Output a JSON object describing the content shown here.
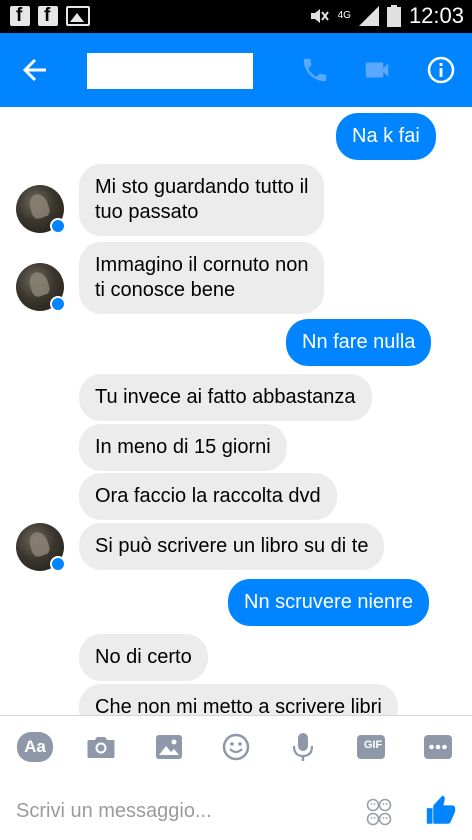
{
  "status_bar": {
    "network": "4G",
    "time": "12:03",
    "icons": [
      "facebook-notification-icon",
      "facebook-notification-icon",
      "gallery-notification-icon",
      "mute-icon",
      "signal-icon",
      "battery-icon"
    ]
  },
  "header": {
    "back_icon": "arrow-left-icon",
    "contact_name": "",
    "actions": [
      "phone-icon",
      "video-camera-icon",
      "info-icon"
    ]
  },
  "messages": [
    {
      "side": "out",
      "text": "Na k fai"
    },
    {
      "side": "in",
      "text": "Mi sto guardando tutto il\ntuo passato",
      "avatar": true
    },
    {
      "side": "in",
      "text": "Immagino il cornuto non\nti conosce bene",
      "avatar": true
    },
    {
      "side": "out",
      "text": "Nn fare nulla"
    },
    {
      "side": "in",
      "text": "Tu invece ai fatto abbastanza"
    },
    {
      "side": "in",
      "text": "In meno di 15 giorni"
    },
    {
      "side": "in",
      "text": "Ora faccio la raccolta dvd"
    },
    {
      "side": "in",
      "text": "Si può scrivere un libro su di te",
      "avatar": true
    },
    {
      "side": "out",
      "text": "Nn scruvere nienre"
    },
    {
      "side": "in",
      "text": "No di certo"
    },
    {
      "side": "in",
      "text": "Che non mi metto a scrivere libri"
    }
  ],
  "composer": {
    "aa_label": "Aa",
    "gif_label": "GIF",
    "placeholder": "Scrivi un messaggio...",
    "tools": [
      "text-format-icon",
      "camera-icon",
      "image-icon",
      "emoji-icon",
      "microphone-icon",
      "gif-icon",
      "more-icon"
    ],
    "colors": {
      "accent": "#0084ff",
      "incoming_bubble": "#ececec",
      "icon_gray": "#8e98a8"
    }
  }
}
